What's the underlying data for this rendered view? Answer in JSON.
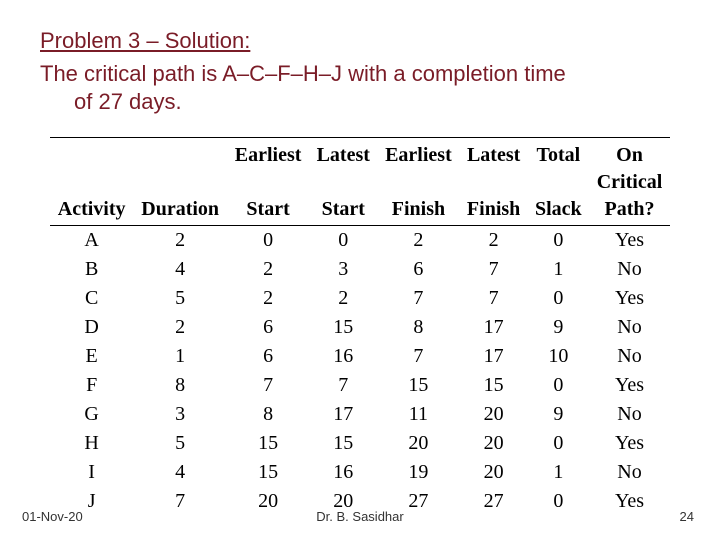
{
  "title": "Problem 3 – Solution:",
  "subtitle_line1": "The critical path is A–C–F–H–J with a completion time",
  "subtitle_line2": "of 27 days.",
  "header": {
    "col1": "Activity",
    "col2": "Duration",
    "col3_top": "Earliest",
    "col3_bot": "Start",
    "col4_top": "Latest",
    "col4_bot": "Start",
    "col5_top": "Earliest",
    "col5_bot": "Finish",
    "col6_top": "Latest",
    "col6_bot": "Finish",
    "col7_top": "Total",
    "col7_bot": "Slack",
    "col8_top": "On",
    "col8_mid": "Critical",
    "col8_bot": "Path?"
  },
  "rows": [
    {
      "activity": "A",
      "duration": "2",
      "es": "0",
      "ls": "0",
      "ef": "2",
      "lf": "2",
      "slack": "0",
      "crit": "Yes"
    },
    {
      "activity": "B",
      "duration": "4",
      "es": "2",
      "ls": "3",
      "ef": "6",
      "lf": "7",
      "slack": "1",
      "crit": "No"
    },
    {
      "activity": "C",
      "duration": "5",
      "es": "2",
      "ls": "2",
      "ef": "7",
      "lf": "7",
      "slack": "0",
      "crit": "Yes"
    },
    {
      "activity": "D",
      "duration": "2",
      "es": "6",
      "ls": "15",
      "ef": "8",
      "lf": "17",
      "slack": "9",
      "crit": "No"
    },
    {
      "activity": "E",
      "duration": "1",
      "es": "6",
      "ls": "16",
      "ef": "7",
      "lf": "17",
      "slack": "10",
      "crit": "No"
    },
    {
      "activity": "F",
      "duration": "8",
      "es": "7",
      "ls": "7",
      "ef": "15",
      "lf": "15",
      "slack": "0",
      "crit": "Yes"
    },
    {
      "activity": "G",
      "duration": "3",
      "es": "8",
      "ls": "17",
      "ef": "11",
      "lf": "20",
      "slack": "9",
      "crit": "No"
    },
    {
      "activity": "H",
      "duration": "5",
      "es": "15",
      "ls": "15",
      "ef": "20",
      "lf": "20",
      "slack": "0",
      "crit": "Yes"
    },
    {
      "activity": "I",
      "duration": "4",
      "es": "15",
      "ls": "16",
      "ef": "19",
      "lf": "20",
      "slack": "1",
      "crit": "No"
    },
    {
      "activity": "J",
      "duration": "7",
      "es": "20",
      "ls": "20",
      "ef": "27",
      "lf": "27",
      "slack": "0",
      "crit": "Yes"
    }
  ],
  "footer": {
    "date": "01-Nov-20",
    "lecturer": "Dr. B. Sasidhar",
    "page": "24"
  },
  "chart_data": {
    "type": "table",
    "title": "Critical Path Analysis – Problem 3",
    "columns": [
      "Activity",
      "Duration",
      "Earliest Start",
      "Latest Start",
      "Earliest Finish",
      "Latest Finish",
      "Total Slack",
      "On Critical Path?"
    ],
    "data": [
      [
        "A",
        2,
        0,
        0,
        2,
        2,
        0,
        "Yes"
      ],
      [
        "B",
        4,
        2,
        3,
        6,
        7,
        1,
        "No"
      ],
      [
        "C",
        5,
        2,
        2,
        7,
        7,
        0,
        "Yes"
      ],
      [
        "D",
        2,
        6,
        15,
        8,
        17,
        9,
        "No"
      ],
      [
        "E",
        1,
        6,
        16,
        7,
        17,
        10,
        "No"
      ],
      [
        "F",
        8,
        7,
        7,
        15,
        15,
        0,
        "Yes"
      ],
      [
        "G",
        3,
        8,
        17,
        11,
        20,
        9,
        "No"
      ],
      [
        "H",
        5,
        15,
        15,
        20,
        20,
        0,
        "Yes"
      ],
      [
        "I",
        4,
        15,
        16,
        19,
        20,
        1,
        "No"
      ],
      [
        "J",
        7,
        20,
        20,
        27,
        27,
        0,
        "Yes"
      ]
    ],
    "critical_path": "A–C–F–H–J",
    "completion_time_days": 27
  }
}
